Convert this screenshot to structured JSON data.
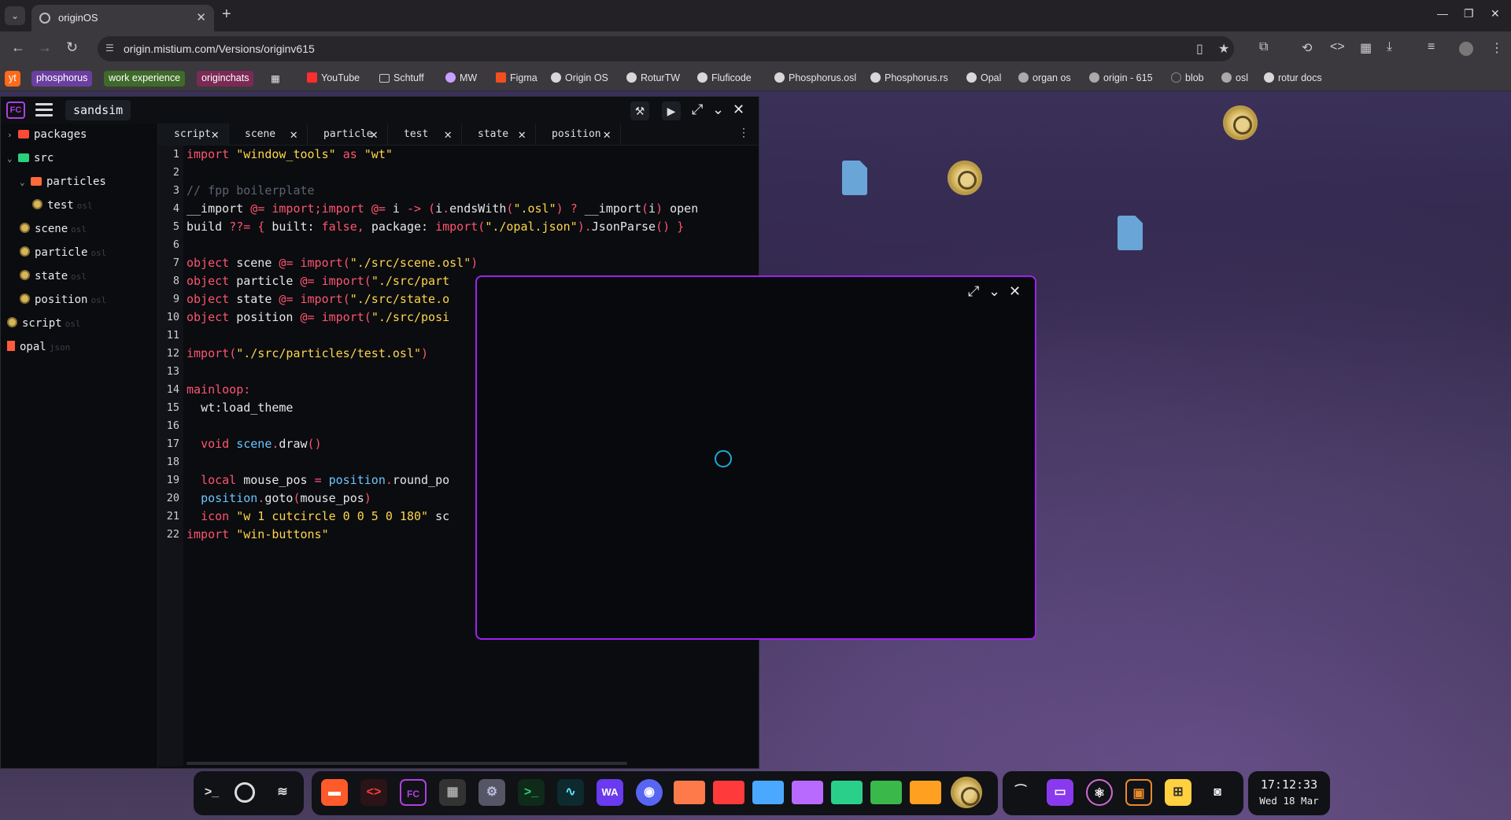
{
  "browser": {
    "tab_title": "originOS",
    "url": "origin.mistium.com/Versions/originv615",
    "bookmarks": [
      {
        "label": "yt",
        "chip": "#ff6a1a"
      },
      {
        "label": "phosphorus",
        "chip": "#6b3fa0"
      },
      {
        "label": "work experience",
        "chip": "#3f6a2a"
      },
      {
        "label": "originchats",
        "chip": "#7a2a55"
      },
      {
        "label": "YouTube"
      },
      {
        "label": "Schtuff"
      },
      {
        "label": "MW"
      },
      {
        "label": "Figma"
      },
      {
        "label": "Origin OS"
      },
      {
        "label": "RoturTW"
      },
      {
        "label": "Fluficode"
      },
      {
        "label": "Phosphorus.osl"
      },
      {
        "label": "Phosphorus.rs"
      },
      {
        "label": "Opal"
      },
      {
        "label": "organ os"
      },
      {
        "label": "origin - 615"
      },
      {
        "label": "blob"
      },
      {
        "label": "osl"
      },
      {
        "label": "rotur docs"
      }
    ]
  },
  "ide": {
    "logo": "FC",
    "project_name": "sandsim",
    "tree": [
      {
        "label": "packages",
        "ext": "",
        "kind": "folder",
        "color": "#ff4a3a",
        "depth": 0,
        "chev": "›"
      },
      {
        "label": "src",
        "ext": "",
        "kind": "folder",
        "color": "#2ad07a",
        "depth": 0,
        "chev": "⌄"
      },
      {
        "label": "particles",
        "ext": "",
        "kind": "folder",
        "color": "#ff6a3a",
        "depth": 1,
        "chev": "⌄"
      },
      {
        "label": "test",
        "ext": "osl",
        "kind": "gear",
        "depth": 2
      },
      {
        "label": "scene",
        "ext": "osl",
        "kind": "gear",
        "depth": 1
      },
      {
        "label": "particle",
        "ext": "osl",
        "kind": "gear",
        "depth": 1
      },
      {
        "label": "state",
        "ext": "osl",
        "kind": "gear",
        "depth": 1
      },
      {
        "label": "position",
        "ext": "osl",
        "kind": "gear",
        "depth": 1
      },
      {
        "label": "script",
        "ext": "osl",
        "kind": "gear",
        "depth": 0
      },
      {
        "label": "opal",
        "ext": "json",
        "kind": "doc",
        "depth": 0
      }
    ],
    "tabs": [
      "script",
      "scene",
      "particle",
      "test",
      "state",
      "position"
    ],
    "line_numbers": [
      "1",
      "2",
      "3",
      "4",
      "5",
      "6",
      "7",
      "8",
      "9",
      "10",
      "11",
      "12",
      "13",
      "14",
      "15",
      "16",
      "17",
      "18",
      "19",
      "20",
      "21",
      "22"
    ],
    "code_lines": [
      "import \"window_tools\" as \"wt\"",
      "",
      "// fpp boilerplate",
      "__import @= import;import @= i -> (i.endsWith(\".osl\") ? __import(i) open",
      "build ??= { built: false, package: import(\"./opal.json\").JsonParse() }",
      "",
      "object scene @= import(\"./src/scene.osl\")",
      "object particle @= import(\"./src/part",
      "object state @= import(\"./src/state.o",
      "object position @= import(\"./src/posi",
      "",
      "import(\"./src/particles/test.osl\")",
      "",
      "mainloop:",
      "  wt:load_theme",
      "",
      "  void scene.draw()",
      "",
      "  local mouse_pos = position.round_po",
      "  position.goto(mouse_pos)",
      "  icon \"w 1 cutcircle 0 0 5 0 180\" sc",
      "import \"win-buttons\""
    ]
  },
  "dock": {
    "apps": [
      "terminal-prompt",
      "origin",
      "layers"
    ],
    "clock_time": "17:12:33",
    "clock_date": "Wed 18 Mar"
  },
  "colors": {
    "accent": "#a020f0",
    "keyword": "#ff5470",
    "string": "#ffd54a",
    "comment": "#5c6370"
  }
}
